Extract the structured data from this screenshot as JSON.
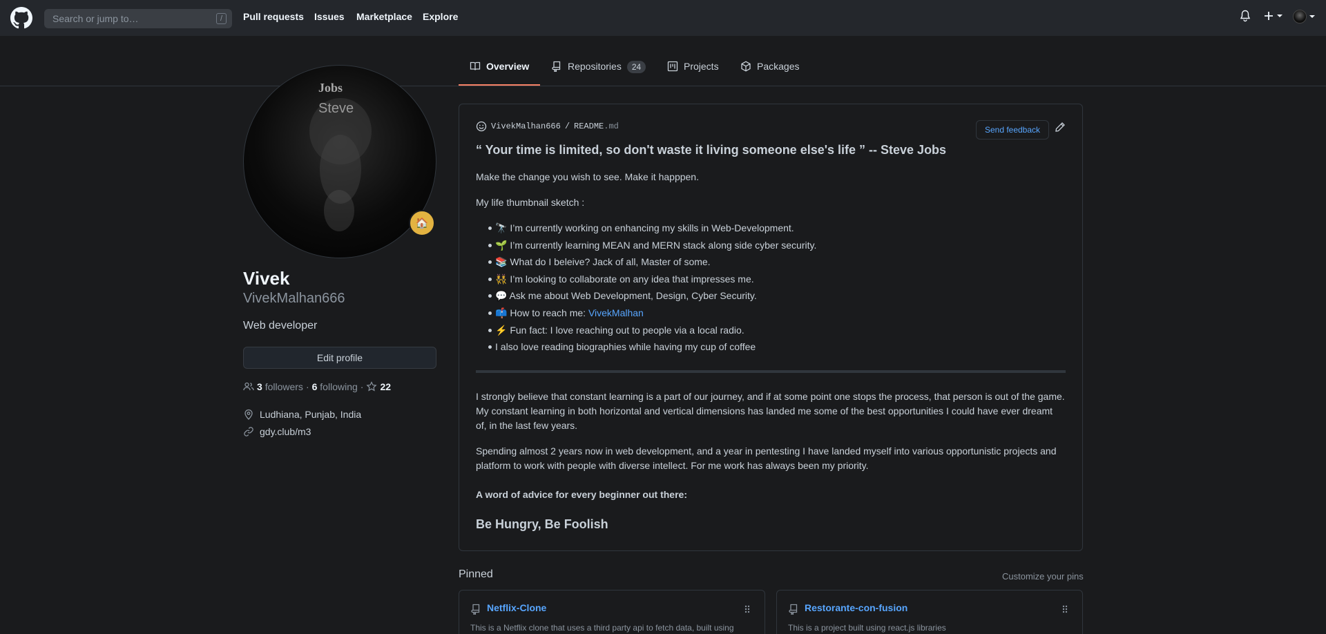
{
  "header": {
    "search_placeholder": "Search or jump to…",
    "search_shortcut": "/",
    "nav": [
      "Pull requests",
      "Issues",
      "Marketplace",
      "Explore"
    ]
  },
  "tabs": [
    {
      "label": "Overview",
      "icon": "book-icon",
      "active": true
    },
    {
      "label": "Repositories",
      "icon": "repo-icon",
      "count": "24"
    },
    {
      "label": "Projects",
      "icon": "project-icon"
    },
    {
      "label": "Packages",
      "icon": "package-icon"
    }
  ],
  "profile": {
    "name": "Vivek",
    "login": "VivekMalhan666",
    "bio": "Web developer",
    "edit_label": "Edit profile",
    "followers_count": "3",
    "followers_label": "followers",
    "following_count": "6",
    "following_label": "following",
    "stars": "22",
    "location": "Ludhiana, Punjab, India",
    "website": "gdy.club/m3",
    "status_emoji": "🏠",
    "avatar_words": [
      "Jobs",
      "Steve"
    ]
  },
  "readme": {
    "owner": "VivekMalhan666",
    "separator": "/",
    "file": "README",
    "ext": ".md",
    "feedback_label": "Send feedback",
    "quote": "“ Your time is limited, so don't waste it living someone else's life ” -- Steve Jobs",
    "tagline": "Make the change you wish to see. Make it happpen.",
    "sketch_title": "My life thumbnail sketch :",
    "bullets": [
      {
        "emoji": "🔭",
        "text": " I’m currently working on enhancing my skills in Web-Development."
      },
      {
        "emoji": "🌱",
        "text": " I’m currently learning MEAN and MERN stack along side cyber security."
      },
      {
        "emoji": "📚",
        "text": " What do I beleive? Jack of all, Master of some."
      },
      {
        "emoji": "👯",
        "text": " I’m looking to collaborate on any idea that impresses me."
      },
      {
        "emoji": "💬",
        "text": " Ask me about Web Development, Design, Cyber Security."
      },
      {
        "emoji": "📫",
        "text": " How to reach me: ",
        "link": "VivekMalhan"
      },
      {
        "emoji": "⚡",
        "text": " Fun fact: I love reaching out to people via a local radio."
      },
      {
        "emoji": "",
        "text": "I also love reading biographies while having my cup of coffee"
      }
    ],
    "para1": "I strongly believe that constant learning is a part of our journey, and if at some point one stops the process, that person is out of the game. My constant learning in both horizontal and vertical dimensions has landed me some of the best opportunities I could have ever dreamt of, in the last few years.",
    "para2": "Spending almost 2 years now in web development, and a year in pentesting I have landed myself into various opportunistic projects and platform to work with people with diverse intellect. For me work has always been my priority.",
    "advice_title": "A word of advice for every beginner out there:",
    "advice": "Be Hungry, Be Foolish"
  },
  "pinned": {
    "title": "Pinned",
    "customize_label": "Customize your pins",
    "cards": [
      {
        "name": "Netflix-Clone",
        "desc": "This is a Netflix clone that uses a third party api to fetch data, built using"
      },
      {
        "name": "Restorante-con-fusion",
        "desc": "This is a project built using react.js libraries"
      }
    ]
  },
  "colors": {
    "accent": "#58a6ff",
    "tab_underline": "#f78166",
    "background": "#1a1b1d"
  }
}
